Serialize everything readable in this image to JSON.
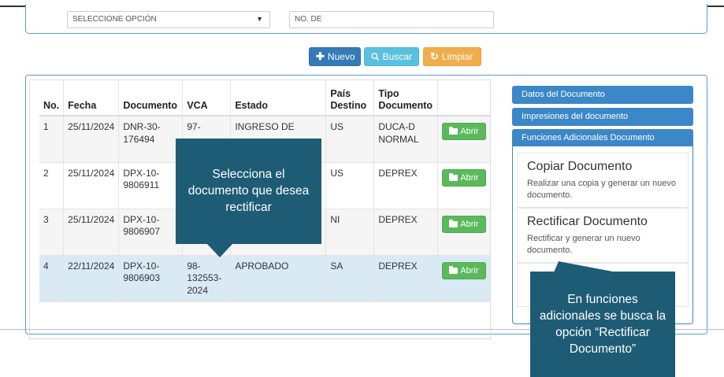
{
  "filters": {
    "select_value": "SELECCIONE OPCIÓN",
    "input_value": "NO. DE"
  },
  "actions": {
    "nuevo_label": "Nuevo",
    "buscar_label": "Buscar",
    "limpiar_label": "Limpiar"
  },
  "table": {
    "headers": {
      "no": "No.",
      "fecha": "Fecha",
      "documento": "Documento",
      "vca": "VCA",
      "estado": "Estado",
      "pais_destino": "País Destino",
      "tipo_documento": "Tipo Documento"
    },
    "rows": [
      {
        "no": "1",
        "fecha": "25/11/2024",
        "documento": "DNR-30-176494",
        "vca": "97-",
        "estado": "INGRESO DE",
        "pais": "US",
        "tipo": "DUCA-D NORMAL",
        "action": "Abrir"
      },
      {
        "no": "2",
        "fecha": "25/11/2024",
        "documento": "DPX-10-9806911",
        "vca": "",
        "estado": "",
        "pais": "US",
        "tipo": "DEPREX",
        "action": "Abrir"
      },
      {
        "no": "3",
        "fecha": "25/11/2024",
        "documento": "DPX-10-9806907",
        "vca": "",
        "estado": "",
        "pais": "NI",
        "tipo": "DEPREX",
        "action": "Abrir"
      },
      {
        "no": "4",
        "fecha": "22/11/2024",
        "documento": "DPX-10-9806903",
        "vca": "98-132553-2024",
        "estado": "APROBADO",
        "pais": "SA",
        "tipo": "DEPREX",
        "action": "Abrir"
      }
    ]
  },
  "sidebar": {
    "datos": "Datos del Documento",
    "impresiones": "Impresiones del documento",
    "funciones": "Funciones Adicionales Documento",
    "items": [
      {
        "title": "Copiar Documento",
        "desc": "Realizar una copia y generar un nuevo documento."
      },
      {
        "title": "Rectificar Documento",
        "desc": "Rectificar y generar un nuevo documento."
      }
    ]
  },
  "callouts": {
    "left": "Selecciona el documento que desea rectificar",
    "right": "En funciones adicionales se busca la opción “Rectificar Documento”"
  },
  "colors": {
    "primary": "#337ab7",
    "info": "#5bc0de",
    "warning": "#f0ad4e",
    "success": "#5cb85c",
    "sidebar_header": "#3c87c8",
    "callout": "#1e5b75",
    "row_selected": "#d9eaf5"
  }
}
